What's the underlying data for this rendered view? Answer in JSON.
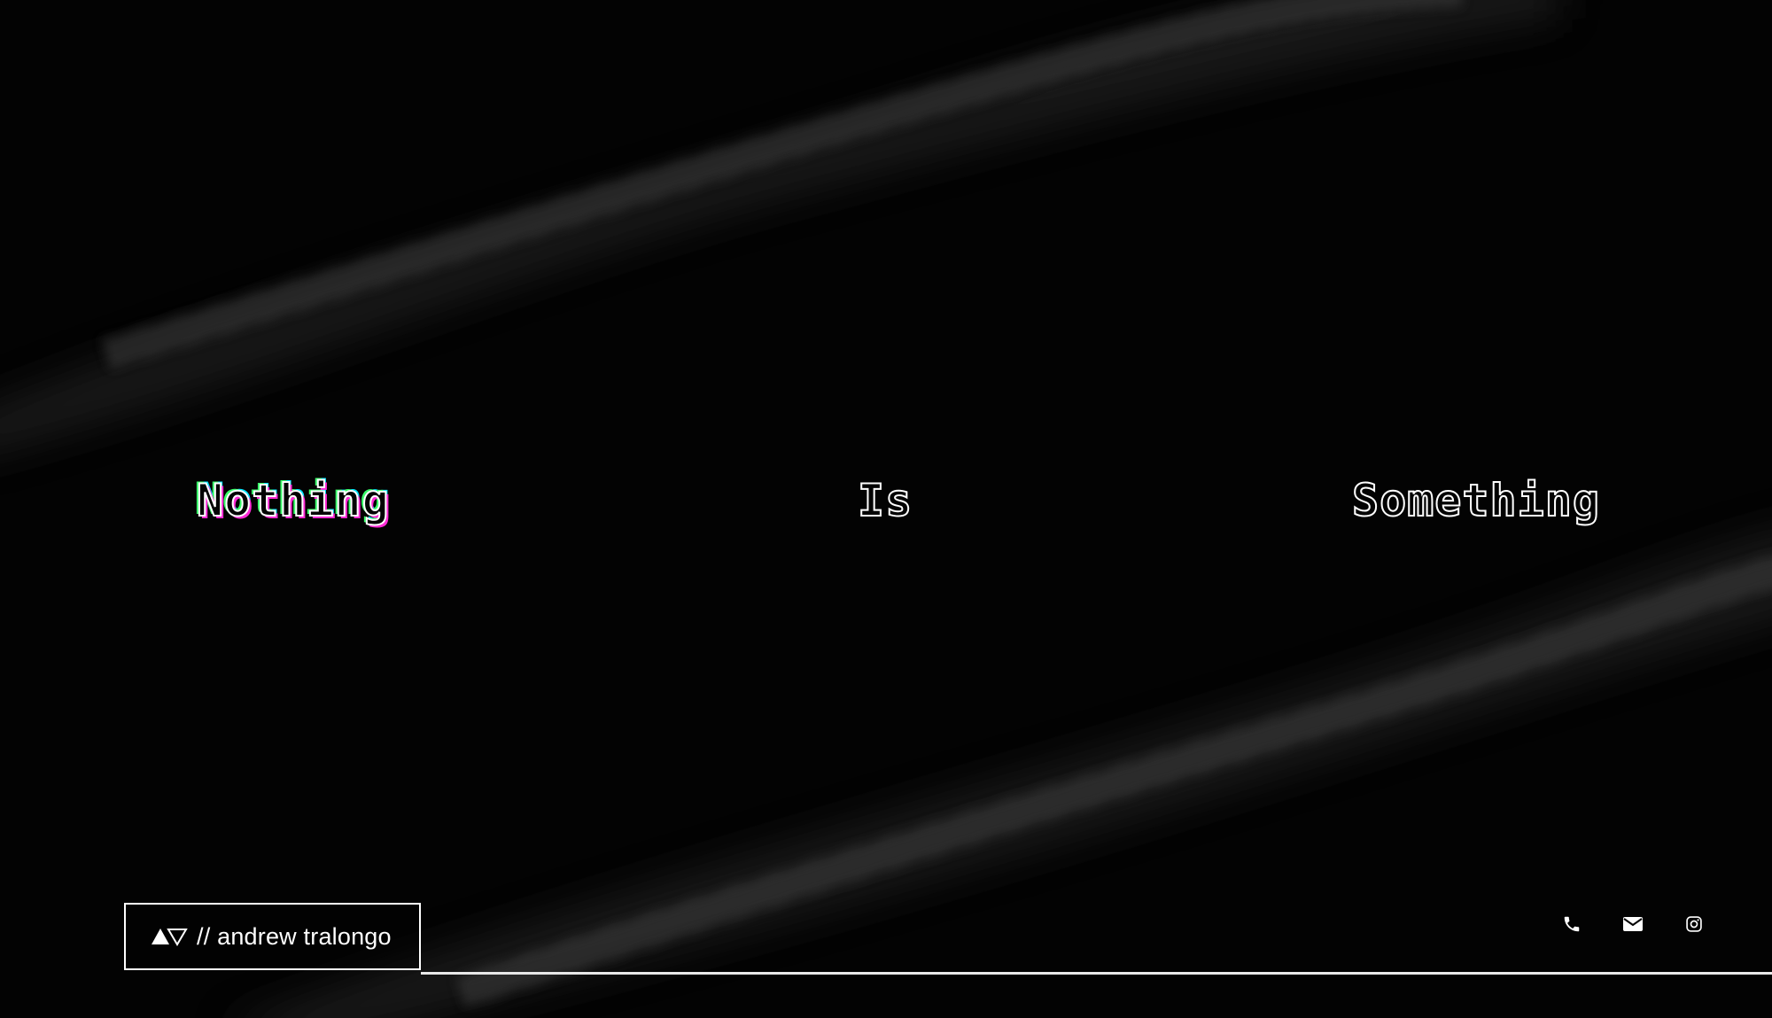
{
  "hero": {
    "words": [
      "Nothing",
      "Is",
      "Something"
    ]
  },
  "brand": {
    "name": "// andrew tralongo",
    "logo_icon": "triangle-pair-logo-icon"
  },
  "contact": {
    "icons": [
      "phone-icon",
      "mail-icon",
      "instagram-icon"
    ]
  },
  "colors": {
    "background": "#030303",
    "text": "#ffffff",
    "glitch_magenta": "#ff2bd6",
    "glitch_green": "#39ff6a",
    "glitch_cyan": "#00e5ff"
  }
}
